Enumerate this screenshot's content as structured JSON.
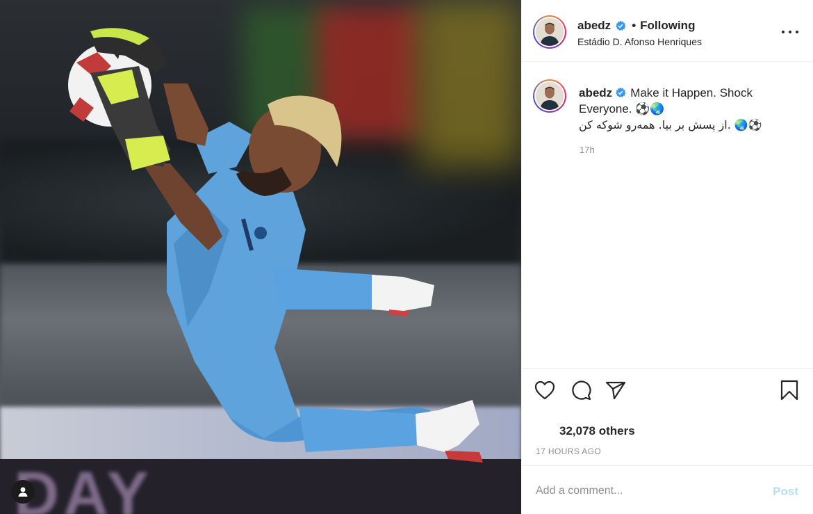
{
  "post": {
    "media_alt": "",
    "user_tag_icon": "person-icon"
  },
  "header": {
    "username": "abedz",
    "separator": "•",
    "follow_state": "Following",
    "location": "Estádio D. Afonso Henriques",
    "more_icon": "ellipsis-icon"
  },
  "caption": {
    "username": "abedz",
    "text_line1": "Make it Happen. Shock Everyone. ⚽🌏",
    "text_line2": "از پسش بر بیا. همه‌رو شوکه کن. 🌏⚽",
    "time": "17h"
  },
  "actions": {
    "like_icon": "heart-icon",
    "comment_icon": "speech-bubble-icon",
    "share_icon": "paper-plane-icon",
    "save_icon": "bookmark-icon"
  },
  "likes": {
    "text": "32,078 others"
  },
  "timestamp": "17 HOURS AGO",
  "comment_box": {
    "placeholder": "Add a comment...",
    "post_label": "Post"
  },
  "colors": {
    "verified": "#3897f0",
    "post_disabled": "#b2dffc",
    "muted": "#8e8e8e",
    "keeper_kit": "#5fa3dc"
  }
}
